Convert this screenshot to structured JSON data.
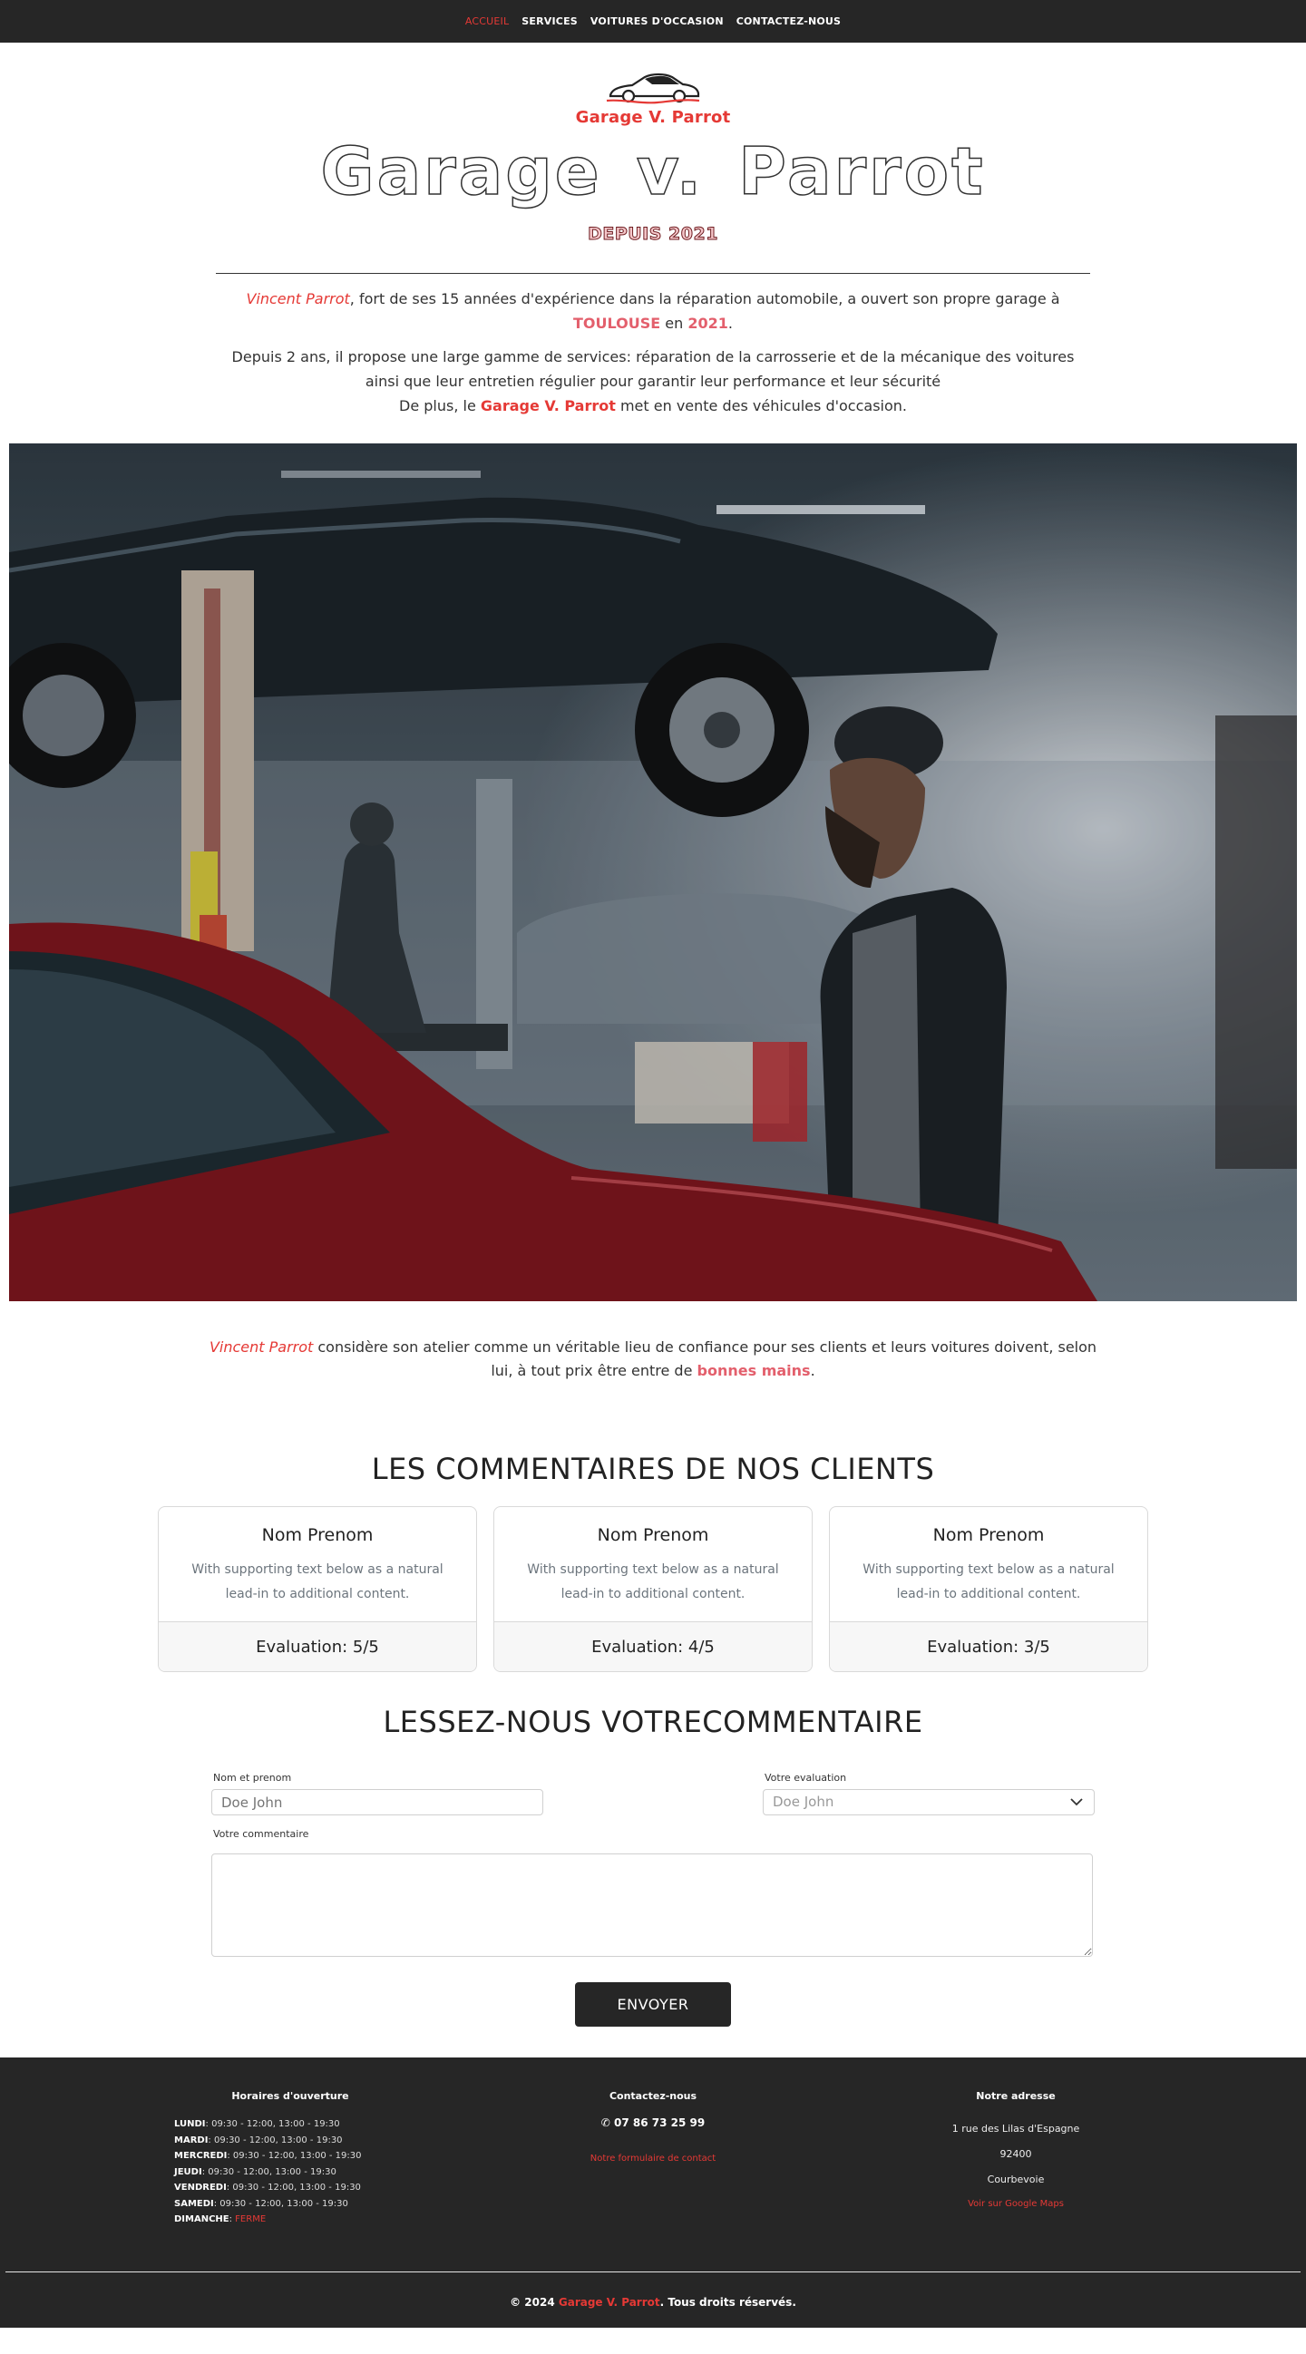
{
  "nav": {
    "items": [
      "ACCUEIL",
      "SERVICES",
      "VOITURES D'OCCASION",
      "CONTACTEZ-NOUS"
    ]
  },
  "hero": {
    "logo_text": "Garage V. Parrot",
    "title": "Garage  v. Parrot",
    "since": "DEPUIS 2021"
  },
  "intro": {
    "p1": {
      "name": "Vincent Parrot",
      "text1": ", fort de ses 15 années d'expérience dans la réparation automobile, a ouvert son propre garage à ",
      "city": "TOULOUSE",
      "text2": " en ",
      "year": "2021",
      "text3": "."
    },
    "p2": "Depuis 2 ans, il propose une large gamme de services: réparation de la carrosserie et de la mécanique des voitures ainsi que leur entretien régulier pour garantir leur performance et leur sécurité",
    "p3": {
      "text1": "De plus, le ",
      "brand": "Garage V. Parrot",
      "text2": " met en vente des véhicules d'occasion."
    }
  },
  "quote": {
    "name": "Vincent Parrot",
    "text1": " considère son atelier comme un véritable lieu de confiance pour ses clients et leurs voitures doivent, selon lui, à tout prix être entre de ",
    "highlight": "bonnes mains",
    "text2": "."
  },
  "reviews": {
    "title": "LES COMMENTAIRES DE NOS CLIENTS",
    "cards": [
      {
        "name": "Nom Prenom",
        "text": "With supporting text below as a natural lead-in to additional content.",
        "rating": "Evaluation: 5/5"
      },
      {
        "name": "Nom Prenom",
        "text": "With supporting text below as a natural lead-in to additional content.",
        "rating": "Evaluation: 4/5"
      },
      {
        "name": "Nom Prenom",
        "text": "With supporting text below as a natural lead-in to additional content.",
        "rating": "Evaluation: 3/5"
      }
    ]
  },
  "form": {
    "title": "LESSEZ-NOUS VOTRECOMMENTAIRE",
    "name_label": "Nom et prenom",
    "name_placeholder": "Doe John",
    "rating_label": "Votre evaluation",
    "rating_value": "Doe John",
    "comment_label": "Votre commentaire",
    "submit": "ENVOYER"
  },
  "footer": {
    "hours_title": "Horaires d'ouverture",
    "hours": [
      {
        "day": "LUNDI",
        "time": " 09:30 - 12:00, 13:00 - 19:30"
      },
      {
        "day": "MARDI",
        "time": " 09:30 - 12:00, 13:00 - 19:30"
      },
      {
        "day": "MERCREDI",
        "time": " 09:30 - 12:00, 13:00 - 19:30"
      },
      {
        "day": "JEUDI",
        "time": " 09:30 - 12:00, 13:00 - 19:30"
      },
      {
        "day": "VENDREDI",
        "time": " 09:30 - 12:00, 13:00 - 19:30"
      },
      {
        "day": "SAMEDI",
        "time": " 09:30 - 12:00, 13:00 - 19:30"
      },
      {
        "day": "DIMANCHE",
        "time": " FERME"
      }
    ],
    "contact_title": "Contactez-nous",
    "phone": "07 86 73 25 99",
    "contact_link": "Notre formulaire de contact",
    "address_title": "Notre adresse",
    "address_line1": "1 rue des Lilas d'Espagne",
    "address_line2": "92400",
    "address_line3": "Courbevoie",
    "maps_link": "Voir sur Google Maps",
    "copyright_pre": "© 2024 ",
    "copyright_brand": "Garage V. Parrot",
    "copyright_post": ". Tous droits réservés."
  },
  "colors": {
    "accent": "#e53935",
    "dark": "#262626"
  }
}
